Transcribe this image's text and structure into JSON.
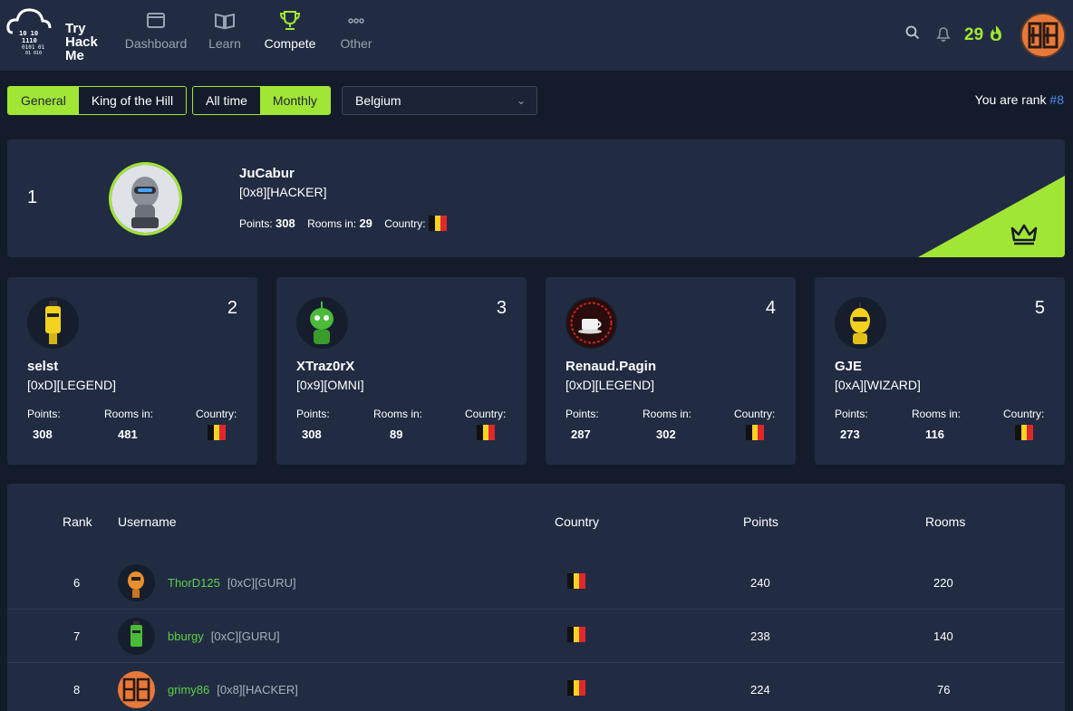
{
  "brand": {
    "name_line1": "Try",
    "name_line2": "Hack",
    "name_line3": "Me"
  },
  "nav": [
    {
      "label": "Dashboard",
      "icon": "dashboard-icon",
      "active": false
    },
    {
      "label": "Learn",
      "icon": "book-icon",
      "active": false
    },
    {
      "label": "Compete",
      "icon": "trophy-icon",
      "active": true
    },
    {
      "label": "Other",
      "icon": "more-icon",
      "active": false
    }
  ],
  "header": {
    "streak": "29"
  },
  "filters": {
    "type": [
      "General",
      "King of the Hill"
    ],
    "type_selected": "General",
    "period": [
      "All time",
      "Monthly"
    ],
    "period_selected": "Monthly",
    "country": "Belgium",
    "rank_label": "You are rank",
    "rank_value": "#8"
  },
  "colors": {
    "accent": "#a2e635",
    "bg": "#141c2b",
    "card": "#212c42",
    "link": "#4d8cf5",
    "username": "#5fd04a"
  },
  "first": {
    "rank": "1",
    "name": "JuCabur",
    "title": "[0x8][HACKER]",
    "points_label": "Points:",
    "points": "308",
    "rooms_label": "Rooms in:",
    "rooms": "29",
    "country_label": "Country:"
  },
  "top_cards": [
    {
      "rank": "2",
      "name": "selst",
      "title": "[0xD][LEGEND]",
      "points": "308",
      "rooms": "481"
    },
    {
      "rank": "3",
      "name": "XTraz0rX",
      "title": "[0x9][OMNI]",
      "points": "308",
      "rooms": "89"
    },
    {
      "rank": "4",
      "name": "Renaud.Pagin",
      "title": "[0xD][LEGEND]",
      "points": "287",
      "rooms": "302"
    },
    {
      "rank": "5",
      "name": "GJE",
      "title": "[0xA][WIZARD]",
      "points": "273",
      "rooms": "116"
    }
  ],
  "card_labels": {
    "points": "Points:",
    "rooms": "Rooms in:",
    "country": "Country:"
  },
  "table": {
    "headers": {
      "rank": "Rank",
      "username": "Username",
      "country": "Country",
      "points": "Points",
      "rooms": "Rooms"
    },
    "rows": [
      {
        "rank": "6",
        "user": "ThorD125",
        "title": "[0xC][GURU]",
        "points": "240",
        "rooms": "220"
      },
      {
        "rank": "7",
        "user": "bburgy",
        "title": "[0xC][GURU]",
        "points": "238",
        "rooms": "140"
      },
      {
        "rank": "8",
        "user": "grimy86",
        "title": "[0x8][HACKER]",
        "points": "224",
        "rooms": "76"
      }
    ]
  }
}
